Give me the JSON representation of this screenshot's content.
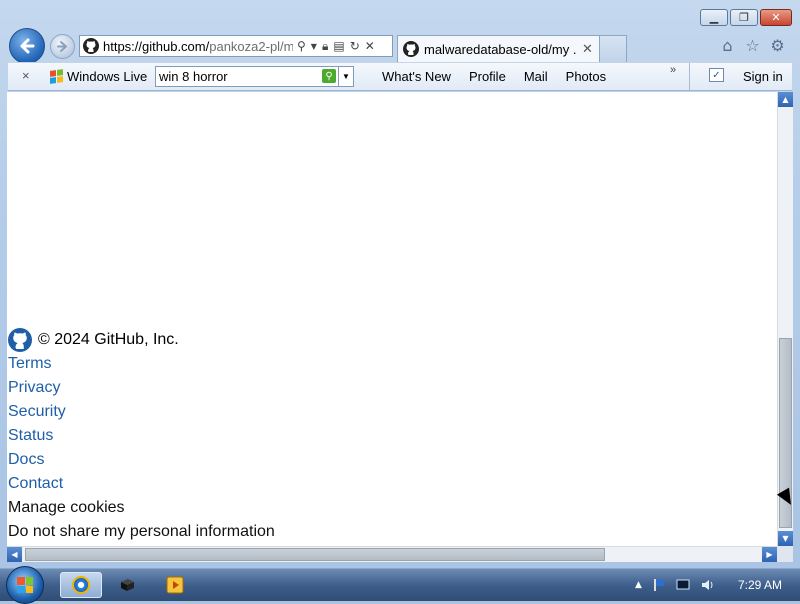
{
  "browser": {
    "address": {
      "host": "https://github.com/",
      "path": "pankoza2-pl/m"
    },
    "tab": {
      "title": "malwaredatabase-old/my ..."
    },
    "toolbar": {
      "close_label": "×",
      "windows_live": "Windows Live",
      "search_value": "win 8 horror",
      "links": [
        "What's New",
        "Profile",
        "Mail",
        "Photos"
      ],
      "more": "»",
      "sign_in": "Sign in"
    }
  },
  "page": {
    "copyright": "© 2024 GitHub, Inc.",
    "footer_links": [
      "Terms",
      "Privacy",
      "Security",
      "Status",
      "Docs",
      "Contact"
    ],
    "footer_text": [
      "Manage cookies",
      "Do not share my personal information"
    ]
  },
  "taskbar": {
    "clock": "7:29 AM"
  },
  "colors": {
    "link": "#1f5fa8",
    "accent": "#1f62b6"
  }
}
